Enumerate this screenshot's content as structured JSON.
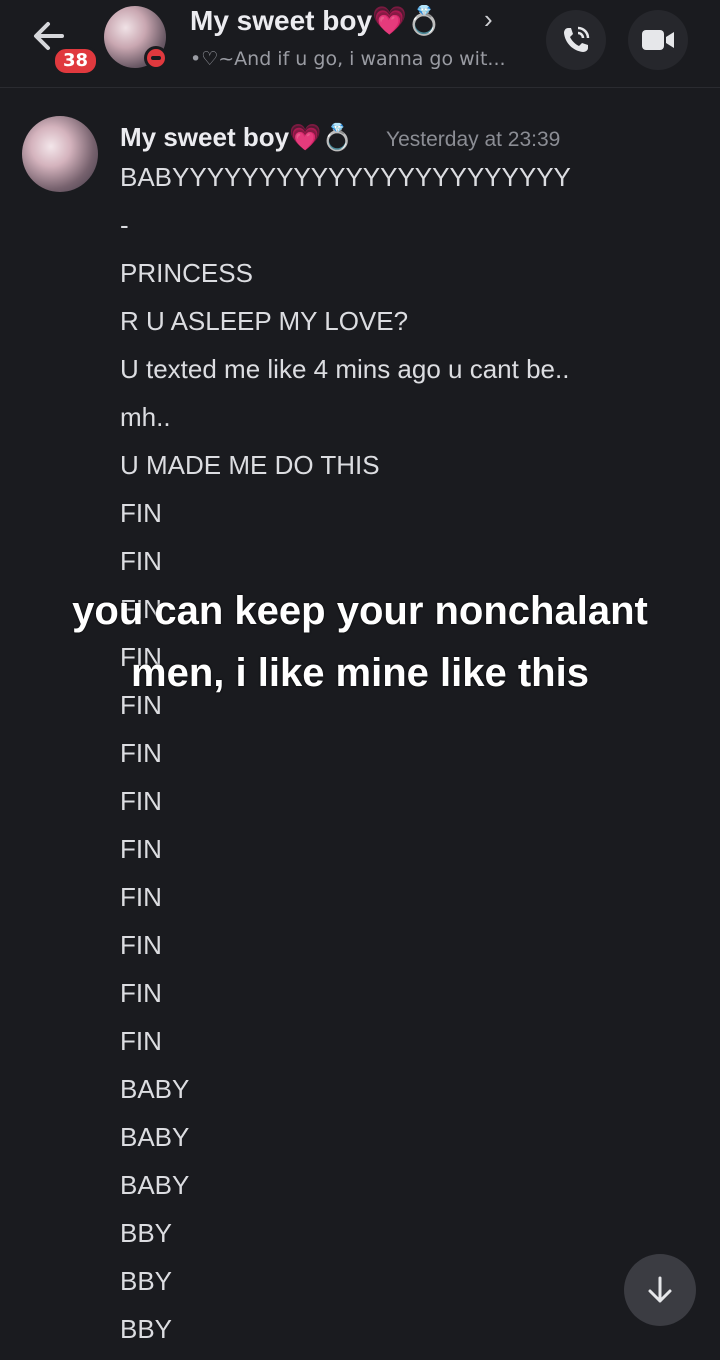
{
  "header": {
    "badge_count": "38",
    "name": "My sweet boy💗💍",
    "status": "•♡~And if u go, i wanna go wit...",
    "chevron": "›"
  },
  "message": {
    "author": "My sweet boy💗💍",
    "timestamp": "Yesterday at 23:39",
    "lines": [
      "BABYYYYYYYYYYYYYYYYYYYYYYY",
      "-",
      "PRINCESS",
      "R U ASLEEP MY LOVE?",
      "U texted me like 4 mins ago u cant be..",
      "mh..",
      "U MADE ME DO THIS",
      "FIN",
      "FIN",
      "FIN",
      "FIN",
      "FIN",
      "FIN",
      "FIN",
      "FIN",
      "FIN",
      "FIN",
      "FIN",
      "FIN",
      "BABY",
      "BABY",
      "BABY",
      "BBY",
      "BBY",
      "BBY"
    ]
  },
  "overlay_caption": "you can keep your nonchalant men, i like mine like this",
  "icons": {
    "back": "arrow-left-icon",
    "call": "phone-icon",
    "video": "video-camera-icon",
    "scroll": "arrow-down-icon"
  },
  "colors": {
    "background": "#1a1b1f",
    "badge": "#e0393e",
    "button": "#26272c"
  }
}
